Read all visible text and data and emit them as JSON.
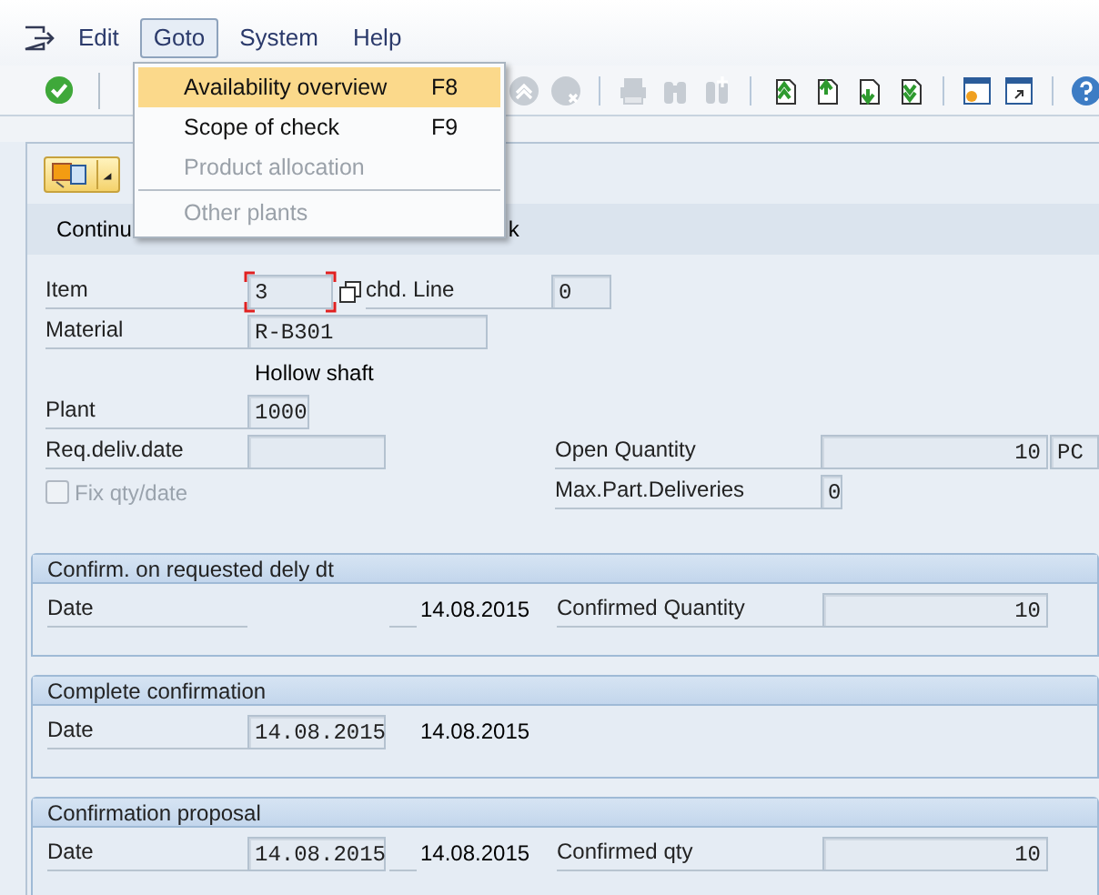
{
  "menu_bar": [
    {
      "label": "Edit",
      "selected": false
    },
    {
      "label": "Goto",
      "selected": true
    },
    {
      "label": "System",
      "selected": false
    },
    {
      "label": "Help",
      "selected": false
    }
  ],
  "goto_menu": [
    {
      "kind": "item",
      "label": "Availability overview",
      "shortcut": "F8",
      "selected": true,
      "disabled": false
    },
    {
      "kind": "item",
      "label": "Scope of check",
      "shortcut": "F9",
      "selected": false,
      "disabled": false
    },
    {
      "kind": "item",
      "label": "Product allocation",
      "selected": false,
      "disabled": true
    },
    {
      "kind": "separator"
    },
    {
      "kind": "item",
      "label": "Other plants",
      "selected": false,
      "disabled": true
    }
  ],
  "app_toolbar": {
    "text_1": "Continu",
    "text_2": "k"
  },
  "form": {
    "item": {
      "label": "Item",
      "value": "3",
      "focused": true
    },
    "sched_line": {
      "label": "chd. Line",
      "value": "0"
    },
    "material": {
      "label": "Material",
      "value": "R-B301"
    },
    "material_text": "Hollow shaft",
    "plant": {
      "label": "Plant",
      "value": "1000"
    },
    "req_deliv_date": {
      "label": "Req.deliv.date"
    },
    "open_quantity": {
      "label": "Open Quantity",
      "value": "10",
      "unit": "PC"
    },
    "fix_qty_date": {
      "label": "Fix qty/date",
      "checked": false,
      "disabled": true
    },
    "max_part_deliveries": {
      "label": "Max.Part.Deliveries",
      "value": "0"
    }
  },
  "groups": [
    {
      "title": "Confirm. on requested dely dt",
      "date_label": "Date",
      "date_text": "14.08.2015",
      "qty_label": "Confirmed Quantity",
      "qty_value": "10"
    },
    {
      "title": "Complete confirmation",
      "date_label": "Date",
      "date_field": "14.08.2015",
      "date_text": "14.08.2015"
    },
    {
      "title": "Confirmation proposal",
      "date_label": "Date",
      "date_field": "14.08.2015",
      "date_text": "14.08.2015",
      "qty_label": "Confirmed qty",
      "qty_value": "10"
    }
  ]
}
